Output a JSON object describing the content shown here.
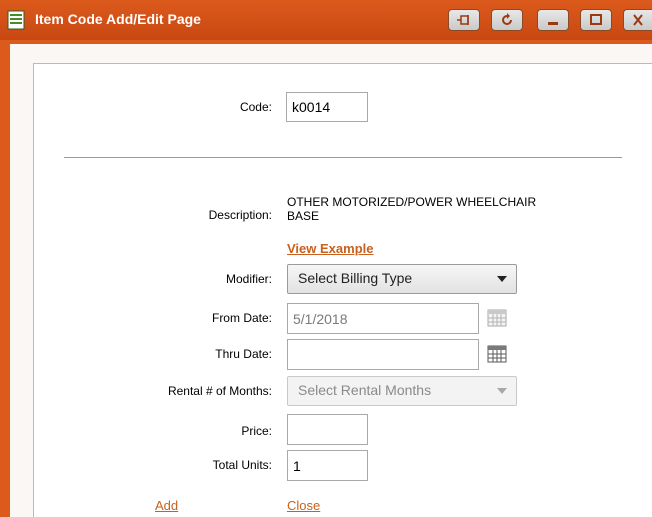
{
  "window": {
    "title": "Item Code Add/Edit Page",
    "colors": {
      "titlebar": "#dc5a1c",
      "link": "#c8601e",
      "button_bg": "#dcdcdc"
    },
    "controls": [
      "pin-icon",
      "refresh-icon",
      "minimize-icon",
      "maximize-icon",
      "close-icon"
    ]
  },
  "form": {
    "code": {
      "label": "Code:",
      "value": "k0014"
    },
    "description": {
      "label": "Description:",
      "line1": "OTHER MOTORIZED/POWER WHEELCHAIR",
      "line2": "BASE"
    },
    "view_example": "View Example",
    "modifier": {
      "label": "Modifier:",
      "selected": "Select Billing Type"
    },
    "from_date": {
      "label": "From Date:",
      "value": "5/1/2018"
    },
    "thru_date": {
      "label": "Thru Date:",
      "value": ""
    },
    "rental_months": {
      "label": "Rental # of Months:",
      "selected": "Select Rental Months"
    },
    "price": {
      "label": "Price:",
      "value": ""
    },
    "total_units": {
      "label": "Total Units:",
      "value": "1"
    }
  },
  "actions": {
    "add": "Add",
    "close": "Close"
  }
}
